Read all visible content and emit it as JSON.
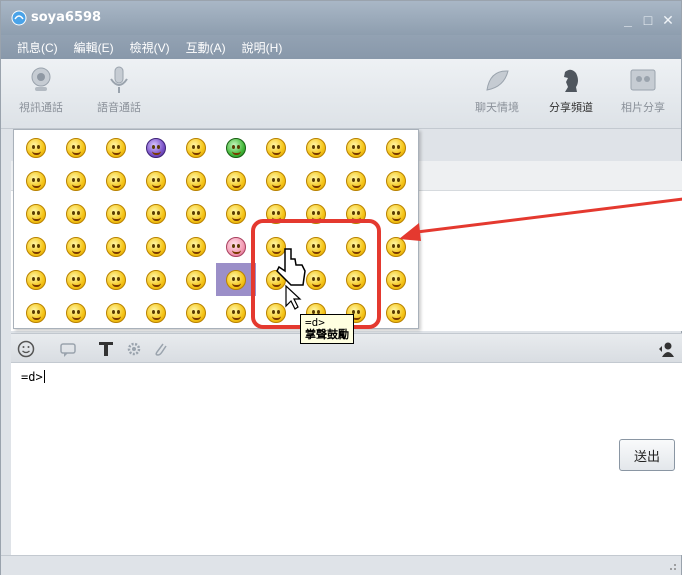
{
  "window": {
    "title": "soya6598"
  },
  "window_controls": {
    "minimize": "_",
    "maximize": "□",
    "close": "✕"
  },
  "menu": [
    "訊息(C)",
    "編輯(E)",
    "檢視(V)",
    "互動(A)",
    "說明(H)"
  ],
  "toolbar": {
    "video_call": "視訊通話",
    "voice_call": "語音通話",
    "chat_mood": "聊天情境",
    "share_channel": "分享頻道",
    "photo_share": "相片分享"
  },
  "input": {
    "value": "=d>"
  },
  "send_button": "送出",
  "tooltip": {
    "code": "=d>",
    "name": "掌聲鼓勵"
  },
  "emoji_panel": {
    "rows": 6,
    "cols": 10,
    "highlighted": {
      "row": 5,
      "col": 6
    }
  },
  "colors": {
    "highlight": "#e4392f",
    "selection": "#9b8fc8",
    "titlebar": "#8e9eaf"
  }
}
